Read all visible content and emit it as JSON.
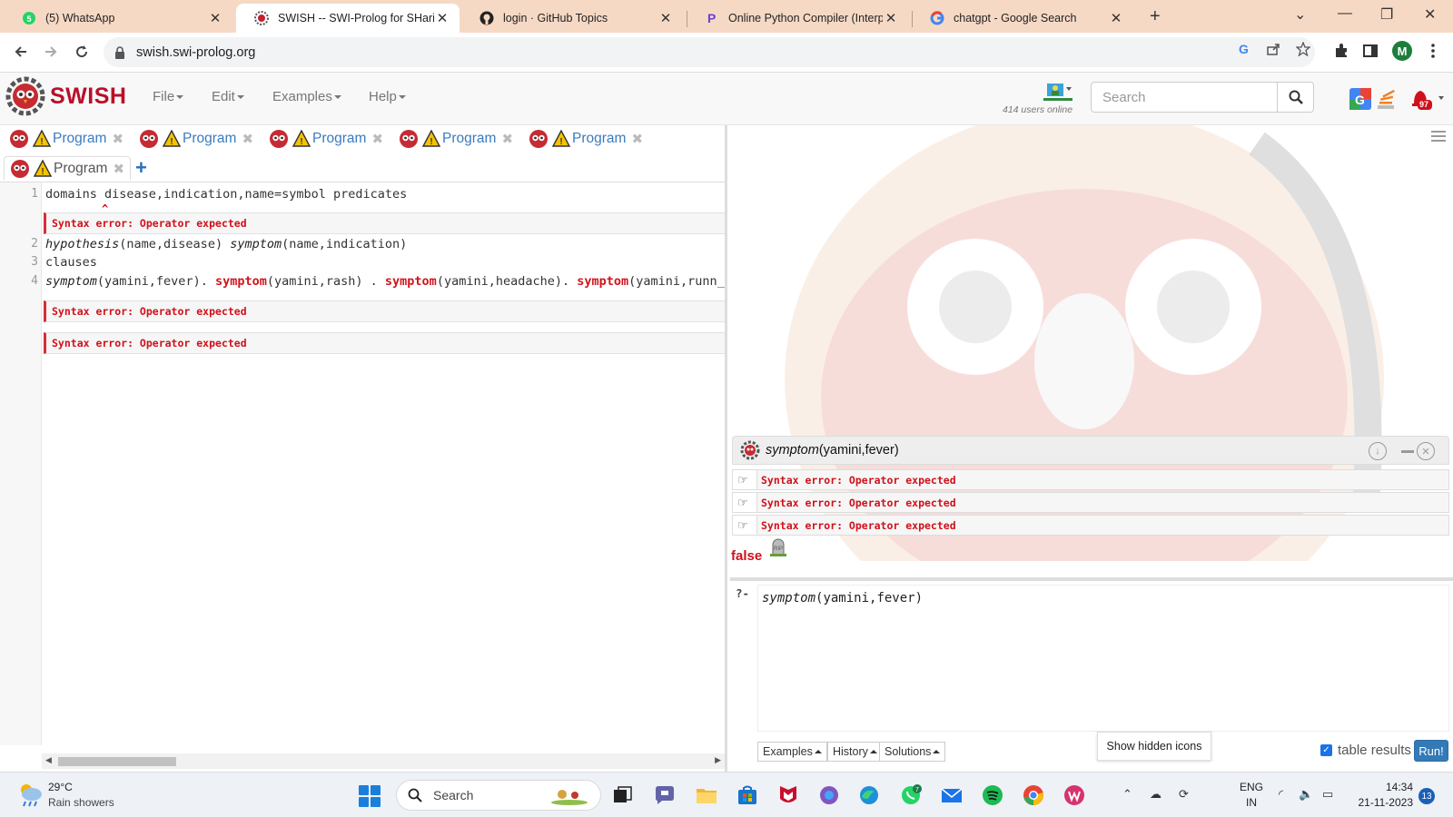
{
  "browser": {
    "tabs": [
      {
        "title": "(5) WhatsApp",
        "icon": "whatsapp-icon"
      },
      {
        "title": "SWISH -- SWI-Prolog for SHarin",
        "icon": "swish-gear-icon",
        "active": true
      },
      {
        "title": "login · GitHub Topics",
        "icon": "github-icon"
      },
      {
        "title": "Online Python Compiler (Interpr",
        "icon": "programiz-icon"
      },
      {
        "title": "chatgpt - Google Search",
        "icon": "google-icon"
      }
    ],
    "url": "swish.swi-prolog.org",
    "profile_initial": "M"
  },
  "swish": {
    "brand": "SWISH",
    "menus": [
      {
        "label": "File"
      },
      {
        "label": "Edit"
      },
      {
        "label": "Examples"
      },
      {
        "label": "Help"
      }
    ],
    "users_online": "414 users online",
    "search_placeholder": "Search",
    "notification_badge": "97"
  },
  "editor": {
    "program_tabs": [
      {
        "label": "Program"
      },
      {
        "label": "Program"
      },
      {
        "label": "Program"
      },
      {
        "label": "Program"
      },
      {
        "label": "Program"
      },
      {
        "label": "Program"
      }
    ],
    "line_numbers": [
      "1",
      "2",
      "3",
      "4"
    ],
    "lines": {
      "l1": "domains disease,indication,name=symbol predicates",
      "l2_a": "hypothesis",
      "l2_b": "(name,disease) ",
      "l2_c": "symptom",
      "l2_d": "(name,indication)",
      "l3": "clauses",
      "l4_a": "symptom",
      "l4_b": "(yamini,fever). ",
      "l4_c": "symptom",
      "l4_d": "(yamini,rash) . ",
      "l4_e": "symptom",
      "l4_f": "(yamini,headache). ",
      "l4_g": "symptom",
      "l4_h": "(yamini,runn_no"
    },
    "errors": [
      "Syntax error: Operator expected",
      "Syntax error: Operator expected",
      "Syntax error: Operator expected"
    ]
  },
  "results": {
    "query_head": "symptom",
    "query_args": "(yamini,fever)",
    "answers": [
      "Syntax error: Operator expected",
      "Syntax error: Operator expected",
      "Syntax error: Operator expected"
    ],
    "result": "false"
  },
  "query_editor": {
    "prompt": "?-",
    "query_head": "symptom",
    "query_args": "(yamini,fever)",
    "buttons": {
      "examples": "Examples",
      "history": "History",
      "solutions": "Solutions",
      "run": "Run!"
    },
    "table_results_label": "table results",
    "table_results_checked": true
  },
  "tooltip": "Show hidden icons",
  "taskbar": {
    "weather_temp": "29°C",
    "weather_desc": "Rain showers",
    "search_label": "Search",
    "lang_1": "ENG",
    "lang_2": "IN",
    "time": "14:34",
    "date": "21-11-2023",
    "notification_count": "13",
    "badge_teams": "7"
  },
  "colors": {
    "brand": "#b8102a",
    "error": "#d0101a",
    "link": "#3a7bbf",
    "run_button": "#337ab7",
    "tabstrip": "#f6d9c5"
  }
}
